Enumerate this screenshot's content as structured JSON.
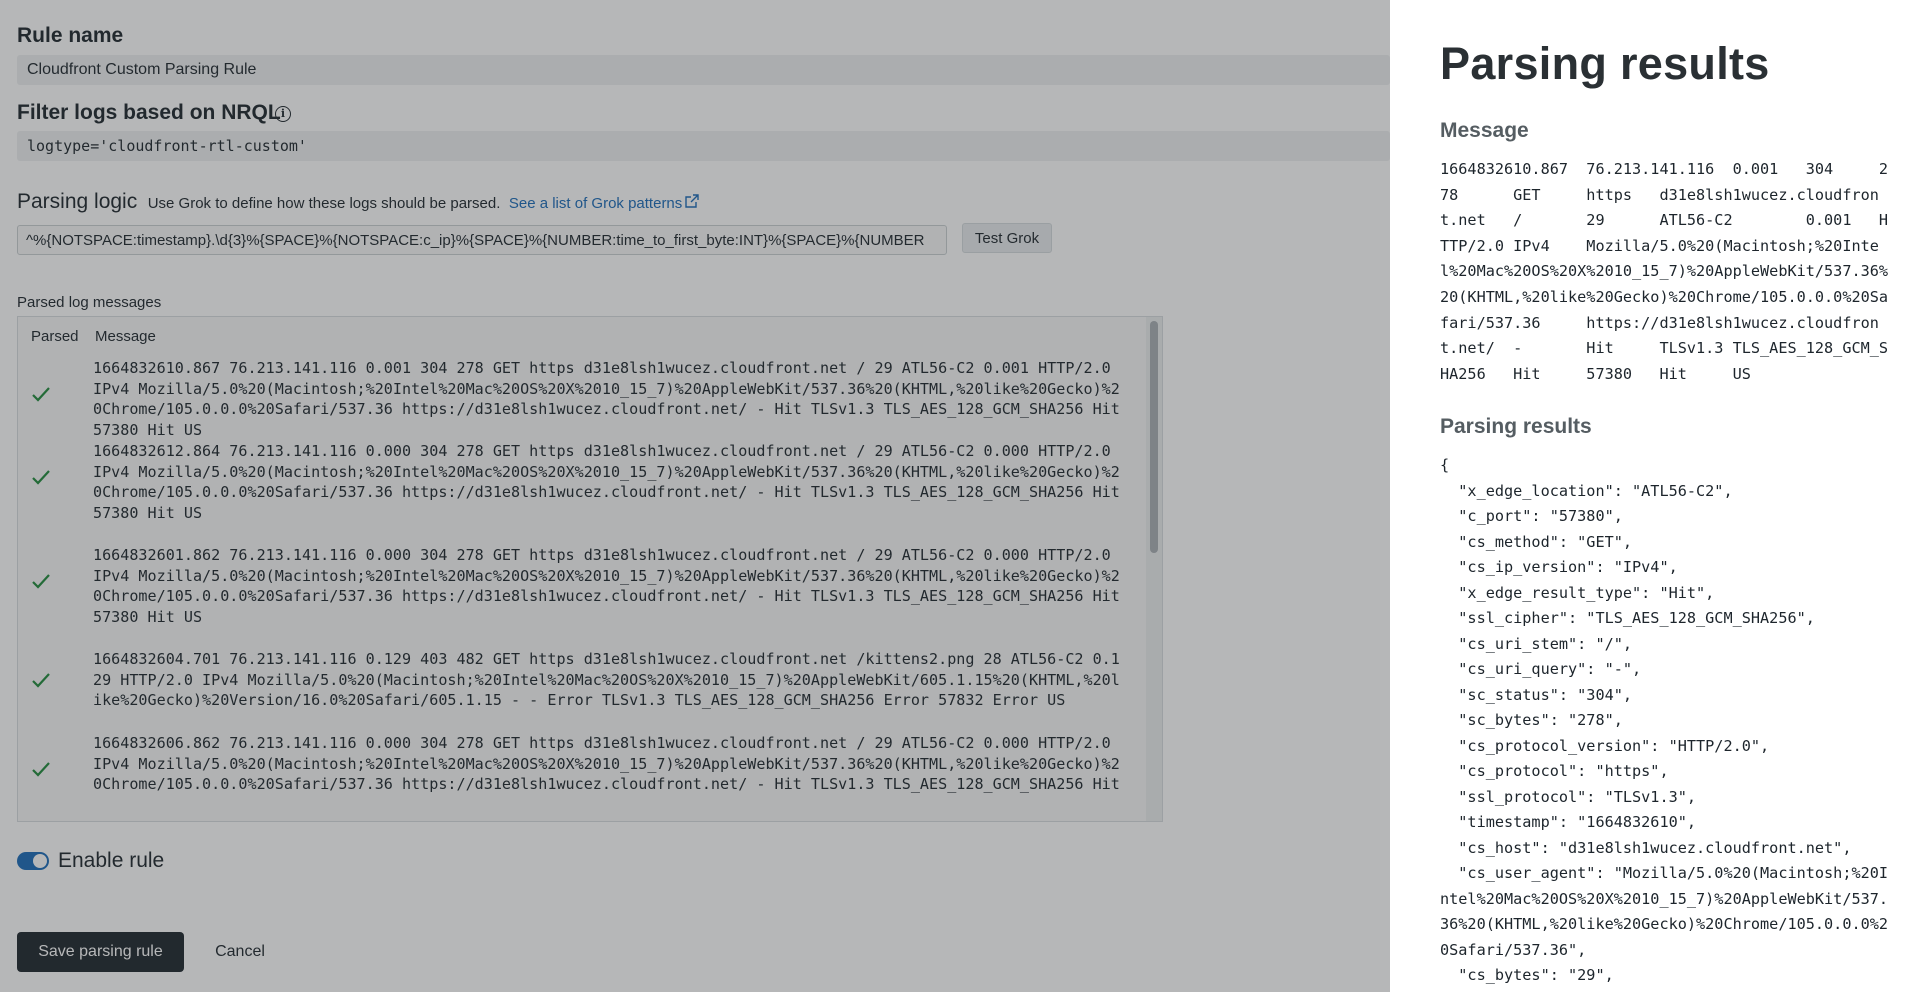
{
  "form": {
    "rule_name_label": "Rule name",
    "rule_name_value": "Cloudfront Custom Parsing Rule",
    "filter_label": "Filter logs based on NRQL",
    "filter_value": "logtype='cloudfront-rtl-custom'",
    "parsing_logic_title": "Parsing logic",
    "parsing_logic_description": "Use Grok to define how these logs should be parsed.",
    "grok_link_label": "See a list of Grok patterns",
    "grok_value": "^%{NOTSPACE:timestamp}.\\d{3}%{SPACE}%{NOTSPACE:c_ip}%{SPACE}%{NUMBER:time_to_first_byte:INT}%{SPACE}%{NUMBER",
    "test_grok_label": "Test Grok",
    "parsed_log_label": "Parsed log messages",
    "columns": [
      "Parsed",
      "Message"
    ],
    "log_rows": [
      {
        "parsed": true,
        "message": "1664832610.867 76.213.141.116 0.001 304 278 GET https d31e8lsh1wucez.cloudfront.net / 29 ATL56-C2 0.001 HTTP/2.0\nIPv4 Mozilla/5.0%20(Macintosh;%20Intel%20Mac%20OS%20X%2010_15_7)%20AppleWebKit/537.36%20(KHTML,%20like%20Gecko)%2\n0Chrome/105.0.0.0%20Safari/537.36 https://d31e8lsh1wucez.cloudfront.net/ - Hit TLSv1.3 TLS_AES_128_GCM_SHA256 Hit\n57380 Hit US"
      },
      {
        "parsed": true,
        "message": "1664832612.864 76.213.141.116 0.000 304 278 GET https d31e8lsh1wucez.cloudfront.net / 29 ATL56-C2 0.000 HTTP/2.0\nIPv4 Mozilla/5.0%20(Macintosh;%20Intel%20Mac%20OS%20X%2010_15_7)%20AppleWebKit/537.36%20(KHTML,%20like%20Gecko)%2\n0Chrome/105.0.0.0%20Safari/537.36 https://d31e8lsh1wucez.cloudfront.net/ - Hit TLSv1.3 TLS_AES_128_GCM_SHA256 Hit\n57380 Hit US"
      },
      {
        "parsed": true,
        "message": "1664832601.862 76.213.141.116 0.000 304 278 GET https d31e8lsh1wucez.cloudfront.net / 29 ATL56-C2 0.000 HTTP/2.0\nIPv4 Mozilla/5.0%20(Macintosh;%20Intel%20Mac%20OS%20X%2010_15_7)%20AppleWebKit/537.36%20(KHTML,%20like%20Gecko)%2\n0Chrome/105.0.0.0%20Safari/537.36 https://d31e8lsh1wucez.cloudfront.net/ - Hit TLSv1.3 TLS_AES_128_GCM_SHA256 Hit\n57380 Hit US"
      },
      {
        "parsed": true,
        "message": "1664832604.701 76.213.141.116 0.129 403 482 GET https d31e8lsh1wucez.cloudfront.net /kittens2.png 28 ATL56-C2 0.1\n29 HTTP/2.0 IPv4 Mozilla/5.0%20(Macintosh;%20Intel%20Mac%20OS%20X%2010_15_7)%20AppleWebKit/605.1.15%20(KHTML,%20l\nike%20Gecko)%20Version/16.0%20Safari/605.1.15 - - Error TLSv1.3 TLS_AES_128_GCM_SHA256 Error 57832 Error US"
      },
      {
        "parsed": true,
        "message": "1664832606.862 76.213.141.116 0.000 304 278 GET https d31e8lsh1wucez.cloudfront.net / 29 ATL56-C2 0.000 HTTP/2.0\nIPv4 Mozilla/5.0%20(Macintosh;%20Intel%20Mac%20OS%20X%2010_15_7)%20AppleWebKit/537.36%20(KHTML,%20like%20Gecko)%2\n0Chrome/105.0.0.0%20Safari/537.36 https://d31e8lsh1wucez.cloudfront.net/ - Hit TLSv1.3 TLS_AES_128_GCM_SHA256 Hit"
      }
    ],
    "enable_rule_label": "Enable rule",
    "enable_rule_on": true,
    "save_label": "Save parsing rule",
    "cancel_label": "Cancel"
  },
  "panel": {
    "title": "Parsing results",
    "message_heading": "Message",
    "message_text": "1664832610.867  76.213.141.116  0.001   304     2\n78      GET     https   d31e8lsh1wucez.cloudfron\nt.net   /       29      ATL56-C2        0.001   H\nTTP/2.0 IPv4    Mozilla/5.0%20(Macintosh;%20Inte\nl%20Mac%20OS%20X%2010_15_7)%20AppleWebKit/537.36%\n20(KHTML,%20like%20Gecko)%20Chrome/105.0.0.0%20Sa\nfari/537.36     https://d31e8lsh1wucez.cloudfron\nt.net/  -       Hit     TLSv1.3 TLS_AES_128_GCM_S\nHA256   Hit     57380   Hit     US",
    "results_heading": "Parsing results",
    "results_json": "{\n  \"x_edge_location\": \"ATL56-C2\",\n  \"c_port\": \"57380\",\n  \"cs_method\": \"GET\",\n  \"cs_ip_version\": \"IPv4\",\n  \"x_edge_result_type\": \"Hit\",\n  \"ssl_cipher\": \"TLS_AES_128_GCM_SHA256\",\n  \"cs_uri_stem\": \"/\",\n  \"cs_uri_query\": \"-\",\n  \"sc_status\": \"304\",\n  \"sc_bytes\": \"278\",\n  \"cs_protocol_version\": \"HTTP/2.0\",\n  \"cs_protocol\": \"https\",\n  \"ssl_protocol\": \"TLSv1.3\",\n  \"timestamp\": \"1664832610\",\n  \"cs_host\": \"d31e8lsh1wucez.cloudfront.net\",\n  \"cs_user_agent\": \"Mozilla/5.0%20(Macintosh;%20I\nntel%20Mac%20OS%20X%2010_15_7)%20AppleWebKit/537.\n36%20(KHTML,%20like%20Gecko)%20Chrome/105.0.0.0%2\n0Safari/537.36\",\n  \"cs_bytes\": \"29\","
  },
  "colors": {
    "accent": "#1a6bb8",
    "success": "#1f8a3b",
    "dark": "#1d252c"
  }
}
